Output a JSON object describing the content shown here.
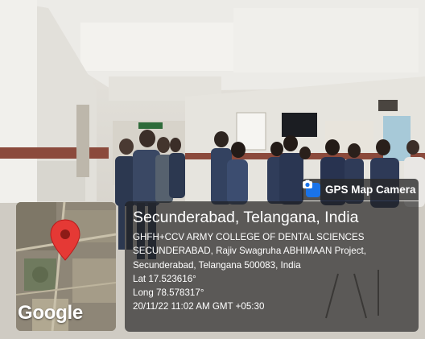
{
  "badge": {
    "icon": "gps-map-camera-icon",
    "label": "GPS Map Camera"
  },
  "map": {
    "pin_color": "#e53935",
    "logo_text": "Google"
  },
  "location": {
    "title": "Secunderabad, Telangana, India",
    "address_lines": [
      "GHFH+CCV ARMY COLLEGE OF DENTAL SCIENCES",
      "SECUNDERABAD, Rajiv Swagruha ABHIMAAN Project,",
      "Secunderabad, Telangana 500083, India"
    ],
    "lat": "Lat 17.523616°",
    "long": "Long 78.578317°",
    "timestamp": "20/11/22 11:02 AM GMT +05:30"
  }
}
